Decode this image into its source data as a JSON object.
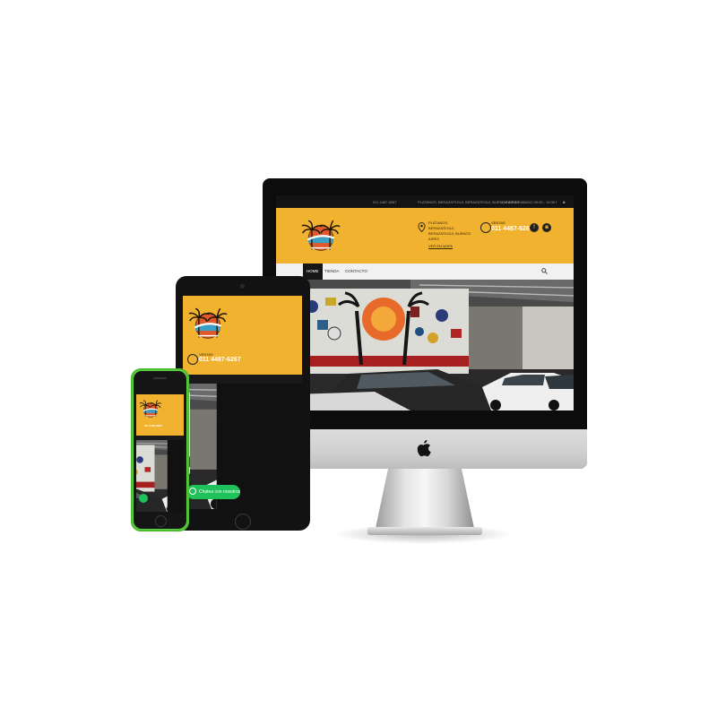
{
  "brand": {
    "accent": "#f1b230",
    "whatsapp_green": "#1fc15a",
    "phone_shell": "#5fd343"
  },
  "desktop": {
    "topbar": {
      "phone": "011 4487-6267",
      "address": "PLATANOS, BERAZATEGUI, BERAZATEGUI, BUENOS AIRES",
      "hours": "LUNES A SABADO 09:00 - 19:30"
    },
    "header": {
      "address_lines": [
        "PLÁTANOS, BERAZATEGUI,",
        "BERAZATEGUI, BUENOS AIRES"
      ],
      "map_link": "VER EN MAPA",
      "sales_label": "VENTAS",
      "phone": "011 4487-6267"
    },
    "nav": [
      {
        "label": "HOME",
        "active": true
      },
      {
        "label": "TIENDA",
        "active": false
      },
      {
        "label": "CONTACTO",
        "active": false
      }
    ],
    "chat_label": "nuestros"
  },
  "tablet": {
    "sales_label": "VENTAS",
    "phone": "011 4487-6267",
    "chat_label": "Chatea con nosotros"
  },
  "phone": {
    "phone_line": "011 4487-6267"
  },
  "icons": [
    "apple-logo-icon",
    "location-pin-icon",
    "phone-icon",
    "facebook-icon",
    "instagram-icon",
    "search-icon",
    "whatsapp-icon"
  ]
}
